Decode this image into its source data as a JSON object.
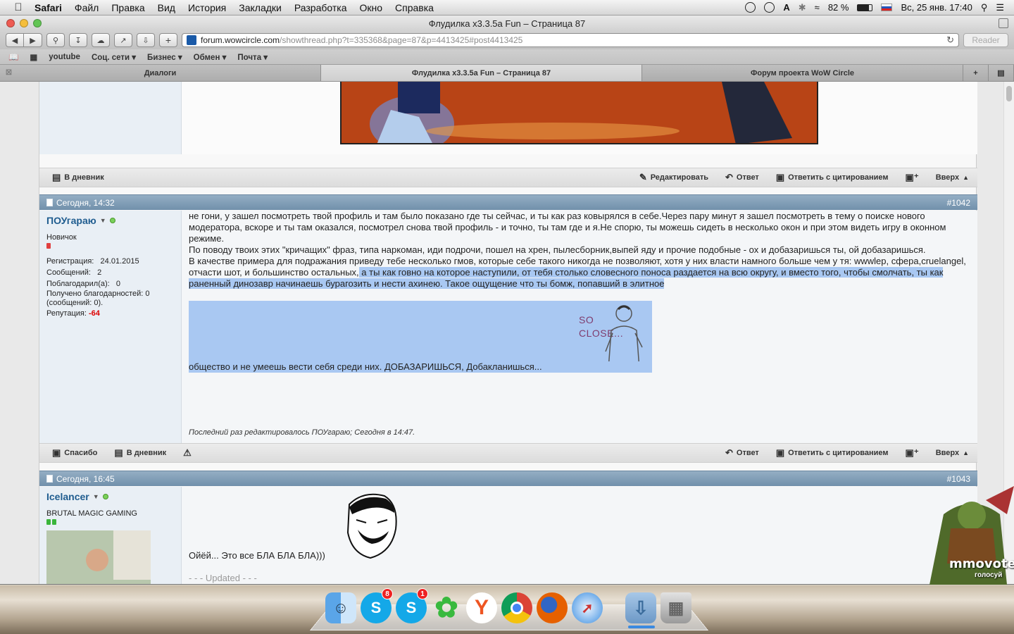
{
  "menubar": {
    "items": [
      "Safari",
      "Файл",
      "Правка",
      "Вид",
      "История",
      "Закладки",
      "Разработка",
      "Окно",
      "Справка"
    ],
    "battery": "82 %",
    "datetime": "Вс, 25 янв.  17:40"
  },
  "window": {
    "title": "Флудилка x3.3.5a Fun – Страница 87",
    "url_host": "forum.wowcircle.com",
    "url_path": "/showthread.php?t=335368&page=87&p=4413425#post4413425",
    "reader_label": "Reader"
  },
  "bookmarks": [
    "youtube",
    "Соц. сети ▾",
    "Бизнес ▾",
    "Обмен ▾",
    "Почта ▾"
  ],
  "tabs": [
    {
      "label": "Диалоги",
      "active": false
    },
    {
      "label": "Флудилка x3.3.5a Fun – Страница 87",
      "active": true
    },
    {
      "label": "Форум проекта WoW Circle",
      "active": false
    }
  ],
  "actions": {
    "diary": "В дневник",
    "edit": "Редактировать",
    "reply": "Ответ",
    "quote_reply": "Ответить с цитированием",
    "top": "Вверх",
    "thanks": "Спасибо"
  },
  "post1042": {
    "date": "Сегодня, 14:32",
    "number": "#1042",
    "username": "ПОУгараю",
    "user_title": "Новичок",
    "reg_label": "Регистрация:",
    "reg_value": "24.01.2015",
    "msgs_label": "Сообщений:",
    "msgs_value": "2",
    "thanked_label": "Поблагодарил(а):",
    "thanked_value": "0",
    "received": "Получено благодарностей: 0 (сообщений: 0).",
    "rep_label": "Репутация:",
    "rep_value": "-64",
    "text1": "не гони, у зашел посмотреть твой профиль и там было показано где ты сейчас, и ты как раз ковырялся в себе.Через пару минут я зашел посмотреть в тему о поиске нового модератора, вскоре и ты там оказался, посмотрел снова твой профиль - и точно, ты там где и я.Не спорю, ты можешь сидеть в несколько окон и при этом видеть игру в оконном режиме.",
    "text2": "По поводу твоих этих \"кричащих\" фраз, типа наркоман, иди подрочи, пошел на хрен, пылесборник,выпей яду и прочие подобные - ох и добазаришься ты, ой добазаришься.",
    "text3_plain": "В качестве примера для подражания приведу тебе несколько гмов, которые себе такого никогда не позволяют, хотя у них власти намного больше чем у тя: wwwlep, сфера,cruelangel, отчасти шот, и большинство остальных,",
    "text3_selected": " а ты как говно на которое наступили, от тебя столько словесного поноса раздается на всю округу, и вместо того, чтобы смолчать, ты как раненный динозавр начинаешь бурагозить и нести ахинею. Такое ощущение что ты бомж, попавший в элитное",
    "meme_text1": "SO",
    "meme_text2": "CLOSE...",
    "text4": "общество и не умеешь вести себя среди них. ДОБАЗАРИШЬСЯ, Добакланишься...",
    "edit_note": "Последний раз редактировалось ПОУгараю; Сегодня в 14:47."
  },
  "post1043": {
    "date": "Сегодня, 16:45",
    "number": "#1043",
    "username": "Icelancer",
    "user_title": "BRUTAL MAGIC GAMING",
    "text": "Ойёй... Это все БЛА БЛА БЛА)))",
    "updated": "- - - Updated - - -"
  },
  "badge": {
    "line1": "mmovote",
    "line2": "голосуй"
  },
  "dock": {
    "skype1_badge": "8",
    "skype2_badge": "1"
  },
  "colors": {
    "selection": "#a9c8f2",
    "post_header": "#7f9db8",
    "username": "#1f5c8f",
    "negative": "#dd0000"
  }
}
